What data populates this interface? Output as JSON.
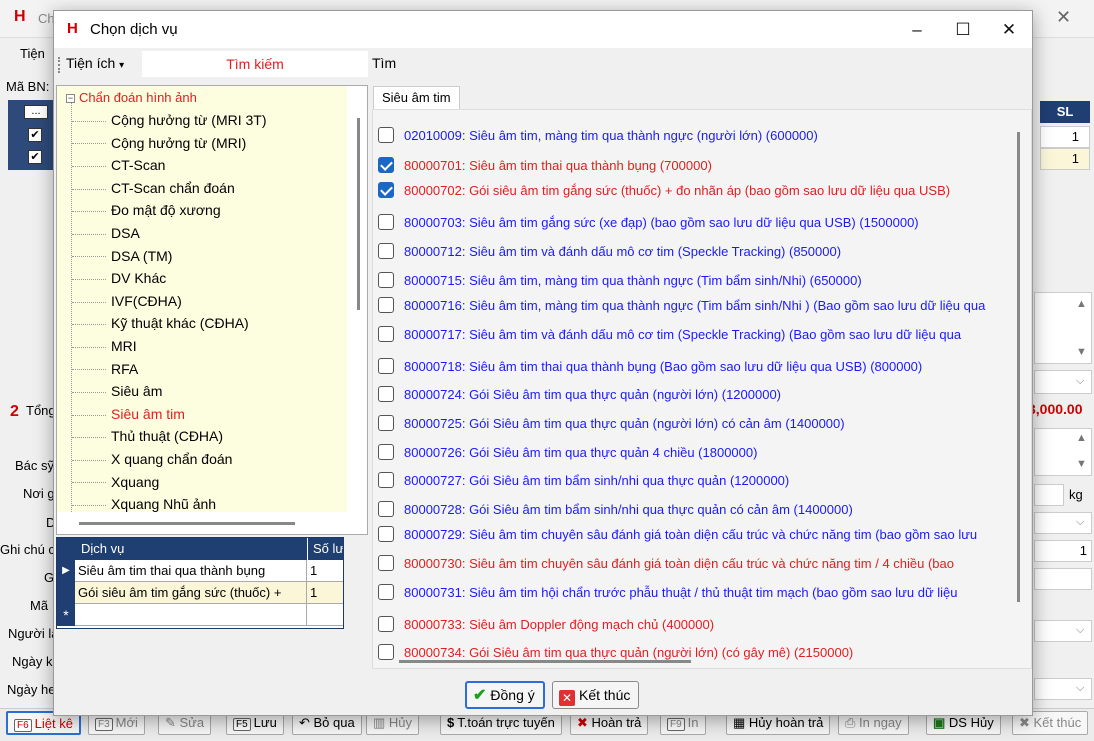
{
  "background": {
    "window_title": "Ch",
    "menu": "Tiện",
    "patient_id_label": "Mã BN:",
    "sl_header": "SL",
    "qty_rows": [
      "1",
      "1"
    ],
    "browse_button": "...",
    "total_label": "Tổng",
    "total_value": "3,000.00",
    "total_index": "2",
    "labels": [
      "Bác sỹ",
      "Nơi g",
      "D",
      "Ghi chú c",
      "G",
      "Mã",
      "Người lâ",
      "Ngày k",
      "Ngày he"
    ],
    "weight_unit": "kg",
    "right_value": "1",
    "bottom_buttons": [
      {
        "key": "F6",
        "label": "Liệt kê",
        "state": "active"
      },
      {
        "key": "F3",
        "label": "Mới",
        "state": "dim"
      },
      {
        "key": "",
        "label": "Sửa",
        "state": "dim"
      },
      {
        "key": "F5",
        "label": "Lưu",
        "state": "normal"
      },
      {
        "key": "",
        "label": "Bỏ qua",
        "state": "normal"
      },
      {
        "key": "",
        "label": "Hủy",
        "state": "dim"
      },
      {
        "key": "$",
        "label": "T.toán trực tuyến",
        "state": "normal"
      },
      {
        "key": "",
        "label": "Hoàn trả",
        "state": "normal"
      },
      {
        "key": "F9",
        "label": "In",
        "state": "dim"
      },
      {
        "key": "",
        "label": "Hủy hoàn trả",
        "state": "normal"
      },
      {
        "key": "",
        "label": "In ngay",
        "state": "dim"
      },
      {
        "key": "",
        "label": "DS Hủy",
        "state": "normal"
      },
      {
        "key": "",
        "label": "Kết thúc",
        "state": "dim"
      }
    ]
  },
  "dialog": {
    "logo": "H",
    "title": "Chọn dịch vụ",
    "toolbar": {
      "utilities_label": "Tiện ích",
      "search_placeholder": "Tìm kiếm",
      "search_button": "Tìm"
    },
    "tree": {
      "root": "Chẩn đoán hình ảnh",
      "items": [
        "Cộng hưởng từ (MRI 3T)",
        "Cộng hưởng từ (MRI)",
        "CT-Scan",
        "CT-Scan chẩn đoán",
        "Đo mật độ xương",
        "DSA",
        "DSA (TM)",
        "DV Khác",
        "IVF(CĐHA)",
        "Kỹ thuật khác (CĐHA)",
        "MRI",
        "RFA",
        "Siêu âm",
        "Siêu âm tim",
        "Thủ thuật (CĐHA)",
        "X quang chẩn đoán",
        "Xquang",
        "Xquang Nhũ ảnh"
      ],
      "selected": "Siêu âm tim"
    },
    "selected_grid": {
      "columns": [
        "Dịch vụ",
        "Số lư"
      ],
      "rows": [
        {
          "service": "Siêu âm tim thai qua thành bụng",
          "qty": "1"
        },
        {
          "service": "Gói siêu âm tim gắng sức (thuốc) +",
          "qty": "1"
        }
      ],
      "new_row_marker": "*"
    },
    "services_tab": "Siêu âm tim",
    "services": [
      {
        "text": "02010009: Siêu âm tim, màng tim qua thành ngực (người lớn) (600000)",
        "checked": false,
        "color": "blue"
      },
      {
        "text": "80000701: Siêu âm tim thai qua thành bụng (700000)",
        "checked": true,
        "color": "red"
      },
      {
        "text": "80000702: Gói siêu âm tim gắng sức (thuốc) + đo nhãn áp (bao gồm sao lưu dữ liệu qua USB)",
        "checked": true,
        "color": "red"
      },
      {
        "text": "80000703: Siêu âm tim gắng sức (xe đạp) (bao gồm sao lưu dữ liệu qua USB) (1500000)",
        "checked": false,
        "color": "blue"
      },
      {
        "text": "80000712: Siêu âm tim và đánh dấu mô cơ tim (Speckle Tracking) (850000)",
        "checked": false,
        "color": "blue"
      },
      {
        "text": "80000715: Siêu âm tim, màng tim qua thành ngực (Tim bẩm sinh/Nhi) (650000)",
        "checked": false,
        "color": "blue"
      },
      {
        "text": "80000716: Siêu âm tim, màng tim qua thành ngực (Tim bẩm sinh/Nhi ) (Bao gồm sao lưu dữ liệu qua",
        "checked": false,
        "color": "blue"
      },
      {
        "text": "80000717: Siêu âm tim và đánh dấu mô cơ tim (Speckle Tracking) (Bao gồm sao lưu dữ liệu qua",
        "checked": false,
        "color": "blue"
      },
      {
        "text": "80000718: Siêu âm tim thai qua thành bụng (Bao gồm sao lưu dữ liệu qua USB) (800000)",
        "checked": false,
        "color": "blue"
      },
      {
        "text": "80000724: Gói Siêu âm tim qua thực quản (người lớn) (1200000)",
        "checked": false,
        "color": "blue"
      },
      {
        "text": "80000725: Gói Siêu âm tim qua thực quản (người lớn) có cản âm (1400000)",
        "checked": false,
        "color": "blue"
      },
      {
        "text": "80000726: Gói Siêu âm tim qua thực quản 4 chiều (1800000)",
        "checked": false,
        "color": "blue"
      },
      {
        "text": "80000727: Gói Siêu âm tim bẩm sinh/nhi qua thực quản (1200000)",
        "checked": false,
        "color": "blue"
      },
      {
        "text": "80000728: Gói Siêu âm tim bẩm sinh/nhi qua thực quản có cản âm (1400000)",
        "checked": false,
        "color": "blue"
      },
      {
        "text": "80000729: Siêu âm tim chuyên sâu đánh giá toàn diện cấu trúc và chức năng tim (bao gồm sao lưu",
        "checked": false,
        "color": "blue"
      },
      {
        "text": "80000730: Siêu âm tim chuyên sâu đánh giá toàn diện cấu trúc và chức năng tim / 4 chiều (bao",
        "checked": false,
        "color": "red"
      },
      {
        "text": "80000731: Siêu âm tim hội chẩn trước phẫu thuật / thủ thuật tim mạch (bao gồm sao lưu dữ liệu",
        "checked": false,
        "color": "blue"
      },
      {
        "text": "80000733: Siêu âm Doppler động mạch chủ (400000)",
        "checked": false,
        "color": "red"
      },
      {
        "text": "80000734: Gói Siêu âm tim qua thực quản (người lớn) (có gây mê) (2150000)",
        "checked": false,
        "color": "red"
      }
    ],
    "buttons": {
      "ok": "Đồng ý",
      "cancel": "Kết thúc"
    },
    "colors": {
      "header_blue": "#1f3f73",
      "link_blue": "#1a1aff",
      "highlight_red": "#e02020",
      "tree_bg": "#fdfde0",
      "checked_blue": "#1c66c4"
    }
  }
}
